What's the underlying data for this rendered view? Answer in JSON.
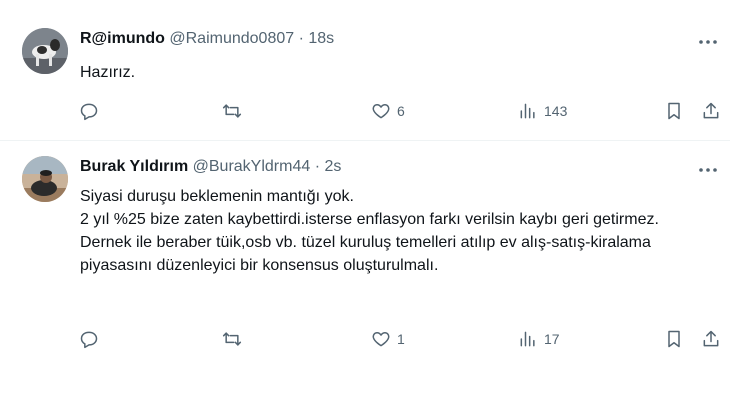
{
  "tweets": [
    {
      "name": "R@imundo",
      "handle": "@Raimundo0807",
      "separator": "·",
      "time": "18s",
      "text": "Hazırız.",
      "stats": {
        "replies": "",
        "reposts": "",
        "likes": "6",
        "views": "143"
      }
    },
    {
      "name": "Burak Yıldırım",
      "handle": "@BurakYldrm44",
      "separator": "·",
      "time": "2s",
      "text": "Siyasi duruşu beklemenin mantığı yok.\n2 yıl %25 bize zaten kaybettirdi.isterse enflasyon farkı verilsin kaybı geri getirmez.\nDernek ile beraber tüik,osb vb. tüzel kuruluş temelleri atılıp ev alış-satış-kiralama piyasasını düzenleyici bir konsensus oluşturulmalı.",
      "stats": {
        "replies": "",
        "reposts": "",
        "likes": "1",
        "views": "17"
      }
    }
  ],
  "colors": {
    "text": "#0f1419",
    "muted": "#536471",
    "divider": "#eff3f4"
  },
  "icons": [
    "more-icon",
    "reply-icon",
    "repost-icon",
    "like-icon",
    "views-icon",
    "bookmark-icon",
    "share-icon"
  ]
}
